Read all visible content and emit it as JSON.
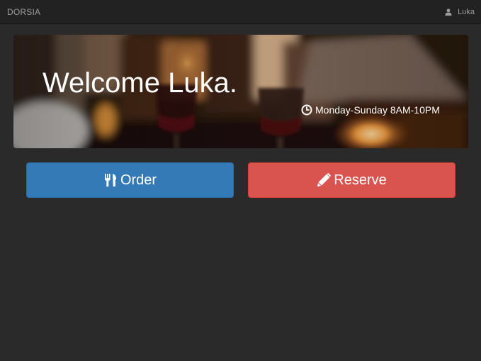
{
  "navbar": {
    "brand": "DORSIA",
    "user_name": "Luka",
    "user_icon": "user-icon"
  },
  "hero": {
    "title": "Welcome Luka.",
    "hours_icon": "clock-icon",
    "hours": "Monday-Sunday 8AM-10PM"
  },
  "actions": {
    "order": {
      "label": "Order",
      "icon": "cutlery-icon",
      "color": "#337ab7"
    },
    "reserve": {
      "label": "Reserve",
      "icon": "pencil-icon",
      "color": "#d9534f"
    }
  },
  "colors": {
    "background": "#2b2a2a",
    "navbar": "#232222",
    "navbar_text": "#9d9d9d"
  }
}
